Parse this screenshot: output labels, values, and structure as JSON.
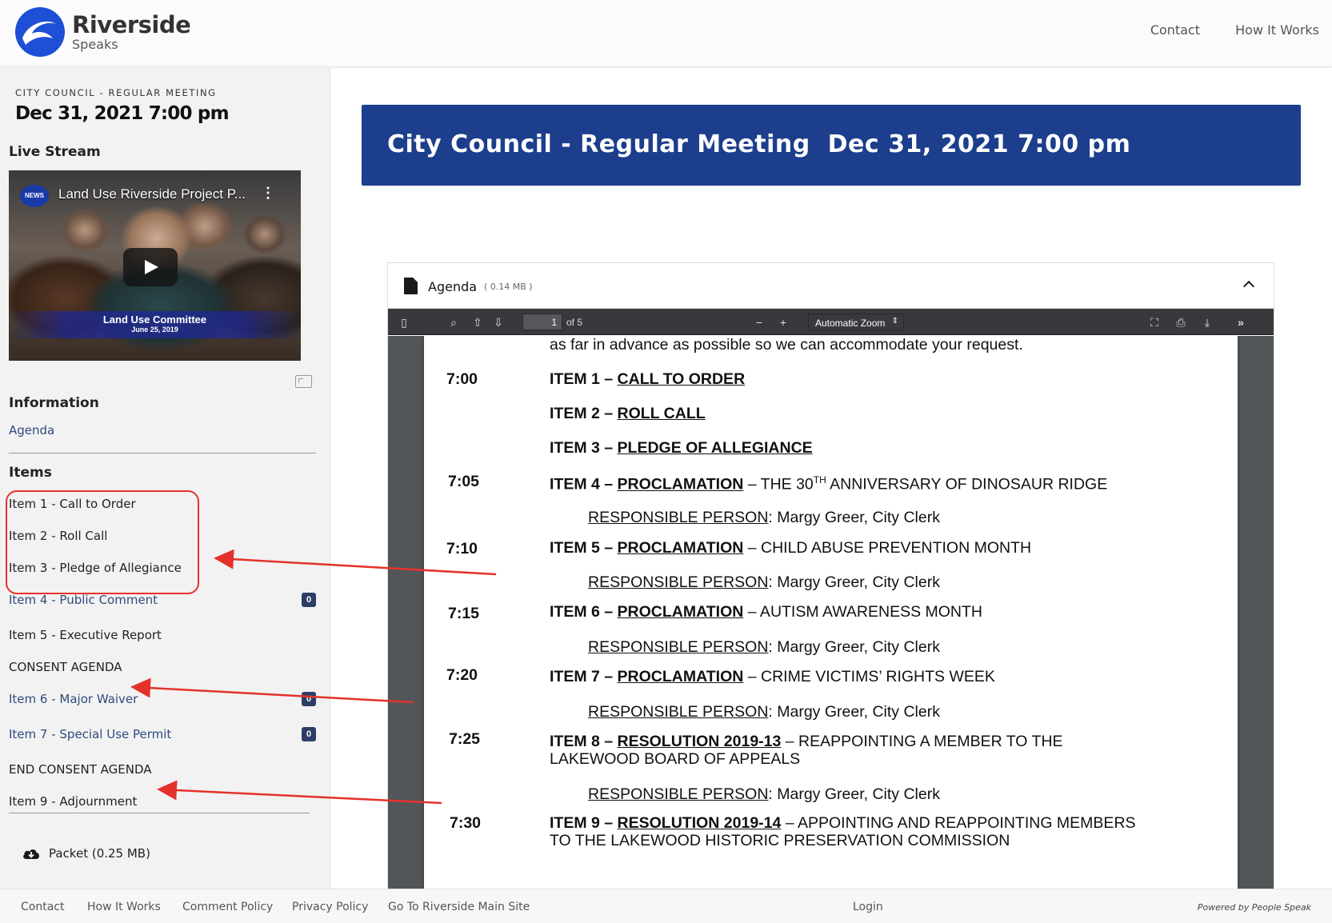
{
  "header": {
    "logo_name": "Riverside",
    "logo_sub": "Speaks",
    "nav": [
      "Contact",
      "How It Works"
    ]
  },
  "sidebar": {
    "kicker": "CITY COUNCIL - REGULAR MEETING",
    "date": "Dec 31, 2021 7:00 pm",
    "live_stream_heading": "Live Stream",
    "video": {
      "title": "Land Use Riverside Project P...",
      "channel_badge": "NEWS",
      "lower_third_1": "Land Use Committee",
      "lower_third_2": "June 25, 2019"
    },
    "information_heading": "Information",
    "agenda_link": "Agenda",
    "items_heading": "Items",
    "items": [
      {
        "label": "Item 1 - Call to Order",
        "link": false
      },
      {
        "label": "Item 2 - Roll Call",
        "link": false
      },
      {
        "label": "Item 3 - Pledge of Allegiance",
        "link": false
      },
      {
        "label": "Item 4 - Public Comment",
        "link": true,
        "count": "0"
      },
      {
        "label": "Item 5 - Executive Report",
        "link": false
      },
      {
        "label": "CONSENT AGENDA",
        "link": false
      },
      {
        "label": "Item 6 - Major Waiver",
        "link": true,
        "count": "0"
      },
      {
        "label": "Item 7 - Special Use Permit",
        "link": true,
        "count": "0"
      },
      {
        "label": "END CONSENT AGENDA",
        "link": false
      },
      {
        "label": "Item 9 - Adjournment",
        "link": false
      }
    ],
    "packet": "Packet (0.25 MB)"
  },
  "main": {
    "banner": "City Council - Regular Meeting  Dec 31, 2021 7:00 pm",
    "doc": {
      "title": "Agenda",
      "size": "( 0.14 MB )",
      "page_current": "1",
      "page_total": "of 5",
      "zoom": "Automatic Zoom"
    },
    "pdf": {
      "intro": "as far in advance as possible so we can accommodate your request.",
      "times": [
        "7:00",
        "7:05",
        "7:10",
        "7:15",
        "7:20",
        "7:25",
        "7:30"
      ],
      "items": [
        {
          "prefix": "ITEM 1 – ",
          "title": "CALL TO ORDER",
          "rest": ""
        },
        {
          "prefix": "ITEM 2 – ",
          "title": "ROLL CALL",
          "rest": ""
        },
        {
          "prefix": "ITEM 3 – ",
          "title": "PLEDGE OF ALLEGIANCE",
          "rest": ""
        },
        {
          "prefix": "ITEM 4 – ",
          "title": "PROCLAMATION",
          "rest": " – THE 30",
          "sup": "TH",
          "rest2": " ANNIVERSARY OF DINOSAUR RIDGE"
        },
        {
          "prefix": "ITEM 5 – ",
          "title": "PROCLAMATION",
          "rest": " – CHILD ABUSE PREVENTION MONTH"
        },
        {
          "prefix": "ITEM 6 – ",
          "title": "PROCLAMATION",
          "rest": " – AUTISM AWARENESS MONTH"
        },
        {
          "prefix": "ITEM 7 – ",
          "title": "PROCLAMATION",
          "rest": " – CRIME VICTIMS’ RIGHTS WEEK"
        },
        {
          "prefix": "ITEM 8 – ",
          "title": "RESOLUTION 2019-13",
          "rest": " – REAPPOINTING A MEMBER TO THE",
          "line2": "LAKEWOOD BOARD OF APPEALS"
        },
        {
          "prefix": "ITEM 9 – ",
          "title": "RESOLUTION 2019-14",
          "rest": " – APPOINTING AND REAPPOINTING MEMBERS",
          "line2": "TO THE LAKEWOOD HISTORIC PRESERVATION COMMISSION"
        }
      ],
      "resp_label": "RESPONSIBLE PERSON",
      "resp_value": ":  Margy Greer, City Clerk"
    }
  },
  "footer": {
    "links": [
      "Contact",
      "How It Works",
      "Comment Policy",
      "Privacy Policy",
      "Go To Riverside Main Site"
    ],
    "login": "Login",
    "powered": "Powered by People Speak"
  },
  "colors": {
    "brand_blue": "#1c3e8c",
    "link": "#2f4a7c",
    "annotation": "#e4322b",
    "badge": "#2c3e66"
  }
}
